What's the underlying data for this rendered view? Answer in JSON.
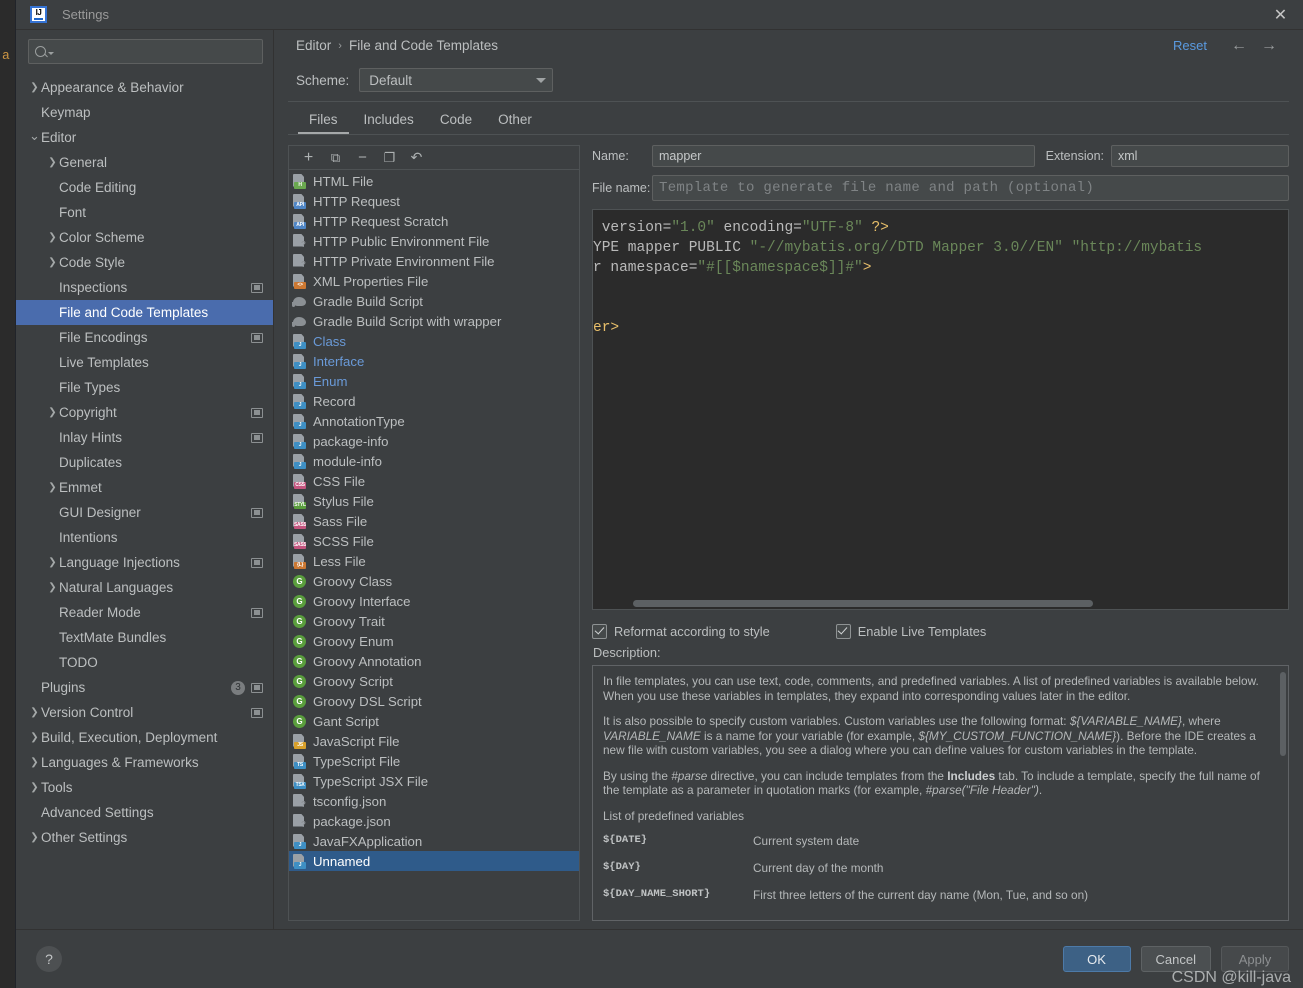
{
  "window": {
    "title": "Settings",
    "logo_text": "IJ",
    "close_icon": "✕"
  },
  "sidebar": {
    "search_placeholder": "",
    "items": [
      {
        "label": "Appearance & Behavior",
        "indent": 0,
        "arrow": "›",
        "screen": false,
        "selected": false
      },
      {
        "label": "Keymap",
        "indent": 0,
        "arrow": "",
        "screen": false,
        "selected": false
      },
      {
        "label": "Editor",
        "indent": 0,
        "arrow": "⌄",
        "screen": false,
        "selected": false
      },
      {
        "label": "General",
        "indent": 1,
        "arrow": "›",
        "screen": false,
        "selected": false
      },
      {
        "label": "Code Editing",
        "indent": 1,
        "arrow": "",
        "screen": false,
        "selected": false
      },
      {
        "label": "Font",
        "indent": 1,
        "arrow": "",
        "screen": false,
        "selected": false
      },
      {
        "label": "Color Scheme",
        "indent": 1,
        "arrow": "›",
        "screen": false,
        "selected": false
      },
      {
        "label": "Code Style",
        "indent": 1,
        "arrow": "›",
        "screen": false,
        "selected": false
      },
      {
        "label": "Inspections",
        "indent": 1,
        "arrow": "",
        "screen": true,
        "selected": false
      },
      {
        "label": "File and Code Templates",
        "indent": 1,
        "arrow": "",
        "screen": false,
        "selected": true
      },
      {
        "label": "File Encodings",
        "indent": 1,
        "arrow": "",
        "screen": true,
        "selected": false
      },
      {
        "label": "Live Templates",
        "indent": 1,
        "arrow": "",
        "screen": false,
        "selected": false
      },
      {
        "label": "File Types",
        "indent": 1,
        "arrow": "",
        "screen": false,
        "selected": false
      },
      {
        "label": "Copyright",
        "indent": 1,
        "arrow": "›",
        "screen": true,
        "selected": false
      },
      {
        "label": "Inlay Hints",
        "indent": 1,
        "arrow": "",
        "screen": true,
        "selected": false
      },
      {
        "label": "Duplicates",
        "indent": 1,
        "arrow": "",
        "screen": false,
        "selected": false
      },
      {
        "label": "Emmet",
        "indent": 1,
        "arrow": "›",
        "screen": false,
        "selected": false
      },
      {
        "label": "GUI Designer",
        "indent": 1,
        "arrow": "",
        "screen": true,
        "selected": false
      },
      {
        "label": "Intentions",
        "indent": 1,
        "arrow": "",
        "screen": false,
        "selected": false
      },
      {
        "label": "Language Injections",
        "indent": 1,
        "arrow": "›",
        "screen": true,
        "selected": false
      },
      {
        "label": "Natural Languages",
        "indent": 1,
        "arrow": "›",
        "screen": false,
        "selected": false
      },
      {
        "label": "Reader Mode",
        "indent": 1,
        "arrow": "",
        "screen": true,
        "selected": false
      },
      {
        "label": "TextMate Bundles",
        "indent": 1,
        "arrow": "",
        "screen": false,
        "selected": false
      },
      {
        "label": "TODO",
        "indent": 1,
        "arrow": "",
        "screen": false,
        "selected": false
      },
      {
        "label": "Plugins",
        "indent": 0,
        "arrow": "",
        "screen": true,
        "badge": "3",
        "selected": false
      },
      {
        "label": "Version Control",
        "indent": 0,
        "arrow": "›",
        "screen": true,
        "selected": false
      },
      {
        "label": "Build, Execution, Deployment",
        "indent": 0,
        "arrow": "›",
        "screen": false,
        "selected": false
      },
      {
        "label": "Languages & Frameworks",
        "indent": 0,
        "arrow": "›",
        "screen": false,
        "selected": false
      },
      {
        "label": "Tools",
        "indent": 0,
        "arrow": "›",
        "screen": false,
        "selected": false
      },
      {
        "label": "Advanced Settings",
        "indent": 0,
        "arrow": "",
        "screen": false,
        "selected": false
      },
      {
        "label": "Other Settings",
        "indent": 0,
        "arrow": "›",
        "screen": false,
        "selected": false
      }
    ]
  },
  "main": {
    "breadcrumb": {
      "root": "Editor",
      "separator": "›",
      "leaf": "File and Code Templates"
    },
    "reset_label": "Reset",
    "nav_back_icon": "←",
    "nav_forward_icon": "→",
    "scheme": {
      "label": "Scheme:",
      "value": "Default"
    },
    "tabs": [
      {
        "label": "Files",
        "active": true
      },
      {
        "label": "Includes",
        "active": false
      },
      {
        "label": "Code",
        "active": false
      },
      {
        "label": "Other",
        "active": false
      }
    ],
    "list_toolbar": [
      {
        "name": "add",
        "glyph": "+"
      },
      {
        "name": "copy-template",
        "glyph": "⧉"
      },
      {
        "name": "remove",
        "glyph": "−"
      },
      {
        "name": "duplicate",
        "glyph": "❐"
      },
      {
        "name": "reset-template",
        "glyph": "↶"
      }
    ],
    "file_list": [
      {
        "label": "HTML File",
        "kind": "page",
        "tag": "H",
        "tag_color": "#6aa84f",
        "blue": false
      },
      {
        "label": "HTTP Request",
        "kind": "page",
        "tag": "API",
        "tag_color": "#4f86c6",
        "blue": false
      },
      {
        "label": "HTTP Request Scratch",
        "kind": "page",
        "tag": "API",
        "tag_color": "#4f86c6",
        "blue": false
      },
      {
        "label": "HTTP Public Environment File",
        "kind": "question",
        "tag": "",
        "tag_color": "",
        "blue": false
      },
      {
        "label": "HTTP Private Environment File",
        "kind": "question",
        "tag": "",
        "tag_color": "",
        "blue": false
      },
      {
        "label": "XML Properties File",
        "kind": "page",
        "tag": "<>",
        "tag_color": "#cc7832",
        "blue": false
      },
      {
        "label": "Gradle Build Script",
        "kind": "gradle",
        "tag": "",
        "tag_color": "",
        "blue": false
      },
      {
        "label": "Gradle Build Script with wrapper",
        "kind": "gradle",
        "tag": "",
        "tag_color": "",
        "blue": false
      },
      {
        "label": "Class",
        "kind": "page",
        "tag": "J",
        "tag_color": "#3e8fc4",
        "blue": true
      },
      {
        "label": "Interface",
        "kind": "page",
        "tag": "J",
        "tag_color": "#3e8fc4",
        "blue": true
      },
      {
        "label": "Enum",
        "kind": "page",
        "tag": "J",
        "tag_color": "#3e8fc4",
        "blue": true
      },
      {
        "label": "Record",
        "kind": "page",
        "tag": "J",
        "tag_color": "#3e8fc4",
        "blue": false
      },
      {
        "label": "AnnotationType",
        "kind": "page",
        "tag": "J",
        "tag_color": "#3e8fc4",
        "blue": false
      },
      {
        "label": "package-info",
        "kind": "page",
        "tag": "J",
        "tag_color": "#3e8fc4",
        "blue": false
      },
      {
        "label": "module-info",
        "kind": "page",
        "tag": "J",
        "tag_color": "#3e8fc4",
        "blue": false
      },
      {
        "label": "CSS File",
        "kind": "page",
        "tag": "CSS",
        "tag_color": "#c4557f",
        "blue": false
      },
      {
        "label": "Stylus File",
        "kind": "page",
        "tag": "STYL",
        "tag_color": "#5a9e3d",
        "blue": false
      },
      {
        "label": "Sass File",
        "kind": "page",
        "tag": "SASS",
        "tag_color": "#c4557f",
        "blue": false
      },
      {
        "label": "SCSS File",
        "kind": "page",
        "tag": "SASS",
        "tag_color": "#c4557f",
        "blue": false
      },
      {
        "label": "Less File",
        "kind": "page",
        "tag": "{L}",
        "tag_color": "#cc7832",
        "blue": false
      },
      {
        "label": "Groovy Class",
        "kind": "circle",
        "tag": "G",
        "tag_color": "#5a9e3d",
        "blue": false
      },
      {
        "label": "Groovy Interface",
        "kind": "circle",
        "tag": "G",
        "tag_color": "#5a9e3d",
        "blue": false
      },
      {
        "label": "Groovy Trait",
        "kind": "circle",
        "tag": "G",
        "tag_color": "#5a9e3d",
        "blue": false
      },
      {
        "label": "Groovy Enum",
        "kind": "circle",
        "tag": "G",
        "tag_color": "#5a9e3d",
        "blue": false
      },
      {
        "label": "Groovy Annotation",
        "kind": "circle",
        "tag": "G",
        "tag_color": "#5a9e3d",
        "blue": false
      },
      {
        "label": "Groovy Script",
        "kind": "circle",
        "tag": "G",
        "tag_color": "#5a9e3d",
        "blue": false
      },
      {
        "label": "Groovy DSL Script",
        "kind": "circle",
        "tag": "G",
        "tag_color": "#5a9e3d",
        "blue": false
      },
      {
        "label": "Gant Script",
        "kind": "circle",
        "tag": "G",
        "tag_color": "#5a9e3d",
        "blue": false
      },
      {
        "label": "JavaScript File",
        "kind": "page",
        "tag": "JS",
        "tag_color": "#d8a02a",
        "blue": false
      },
      {
        "label": "TypeScript File",
        "kind": "page",
        "tag": "TS",
        "tag_color": "#3e8fc4",
        "blue": false
      },
      {
        "label": "TypeScript JSX File",
        "kind": "page",
        "tag": "TSX",
        "tag_color": "#3e8fc4",
        "blue": false
      },
      {
        "label": "tsconfig.json",
        "kind": "question",
        "tag": "",
        "tag_color": "",
        "blue": false
      },
      {
        "label": "package.json",
        "kind": "question",
        "tag": "",
        "tag_color": "",
        "blue": false
      },
      {
        "label": "JavaFXApplication",
        "kind": "page",
        "tag": "J",
        "tag_color": "#3e8fc4",
        "blue": false
      },
      {
        "label": "Unnamed",
        "kind": "page",
        "tag": "J",
        "tag_color": "#3e8fc4",
        "blue": false,
        "selected": true
      }
    ],
    "detail": {
      "name_label": "Name:",
      "name_value": "mapper",
      "extension_label": "Extension:",
      "extension_value": "xml",
      "filename_label": "File name:",
      "filename_placeholder": "Template to generate file name and path (optional)",
      "code_lines": [
        {
          "segments": [
            {
              "t": " version=",
              "c": "attr"
            },
            {
              "t": "\"1.0\"",
              "c": "str"
            },
            {
              "t": " encoding=",
              "c": "attr"
            },
            {
              "t": "\"UTF-8\"",
              "c": "str"
            },
            {
              "t": " ?>",
              "c": "tag"
            }
          ]
        },
        {
          "segments": [
            {
              "t": "YPE mapper PUBLIC ",
              "c": "attr"
            },
            {
              "t": "\"-//mybatis.org//DTD Mapper 3.0//EN\" \"http://mybatis",
              "c": "str"
            }
          ]
        },
        {
          "segments": [
            {
              "t": "r namespace=",
              "c": "attr"
            },
            {
              "t": "\"#[[$namespace$]]#\"",
              "c": "str"
            },
            {
              "t": ">",
              "c": "tag"
            }
          ]
        },
        {
          "segments": []
        },
        {
          "segments": []
        },
        {
          "segments": [
            {
              "t": "er>",
              "c": "tag"
            }
          ]
        }
      ],
      "checkboxes": [
        {
          "label": "Reformat according to style",
          "checked": true
        },
        {
          "label": "Enable Live Templates",
          "checked": true
        }
      ],
      "description_label": "Description:",
      "description_paragraphs": [
        "In file templates, you can use text, code, comments, and predefined variables. A list of predefined variables is available below. When you use these variables in templates, they expand into corresponding values later in the editor.",
        "It is also possible to specify custom variables. Custom variables use the following format: ${VARIABLE_NAME}, where VARIABLE_NAME is a name for your variable (for example, ${MY_CUSTOM_FUNCTION_NAME}). Before the IDE creates a new file with custom variables, you see a dialog where you can define values for custom variables in the template.",
        "By using the #parse directive, you can include templates from the Includes tab. To include a template, specify the full name of the template as a parameter in quotation marks (for example, #parse(\"File Header\").",
        "List of predefined variables"
      ],
      "variables": [
        {
          "name": "${DATE}",
          "desc": "Current system date"
        },
        {
          "name": "${DAY}",
          "desc": "Current day of the month"
        },
        {
          "name": "${DAY_NAME_SHORT}",
          "desc": "First three letters of the current day name (Mon, Tue, and so on)"
        }
      ]
    }
  },
  "footer": {
    "help_icon": "?",
    "ok_label": "OK",
    "cancel_label": "Cancel",
    "apply_label": "Apply"
  },
  "watermark": "CSDN @kill-java"
}
